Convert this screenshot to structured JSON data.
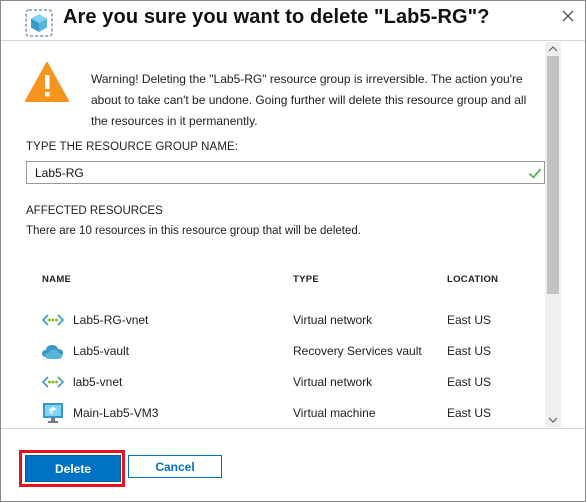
{
  "dialog": {
    "title": "Are you sure you want to delete \"Lab5-RG\"?"
  },
  "warning": {
    "text": "Warning! Deleting the \"Lab5-RG\" resource group is irreversible. The action you're about to take can't be undone. Going further will delete this resource group and all the resources in it permanently."
  },
  "confirm": {
    "label": "TYPE THE RESOURCE GROUP NAME:",
    "value": "Lab5-RG"
  },
  "affected": {
    "heading": "AFFECTED RESOURCES",
    "description": "There are 10 resources in this resource group that will be deleted."
  },
  "table": {
    "columns": [
      "NAME",
      "TYPE",
      "LOCATION"
    ],
    "rows": [
      {
        "name": "Lab5-RG-vnet",
        "type": "Virtual network",
        "location": "East US",
        "icon": "virtual-network-icon"
      },
      {
        "name": "Lab5-vault",
        "type": "Recovery Services vault",
        "location": "East US",
        "icon": "recovery-vault-icon"
      },
      {
        "name": "lab5-vnet",
        "type": "Virtual network",
        "location": "East US",
        "icon": "virtual-network-icon"
      },
      {
        "name": "Main-Lab5-VM3",
        "type": "Virtual machine",
        "location": "East US",
        "icon": "virtual-machine-icon"
      }
    ]
  },
  "buttons": {
    "delete": "Delete",
    "cancel": "Cancel"
  },
  "colors": {
    "accent": "#0072c6",
    "warning": "#f7941d",
    "highlight": "#e81123",
    "success": "#5cb85c"
  }
}
